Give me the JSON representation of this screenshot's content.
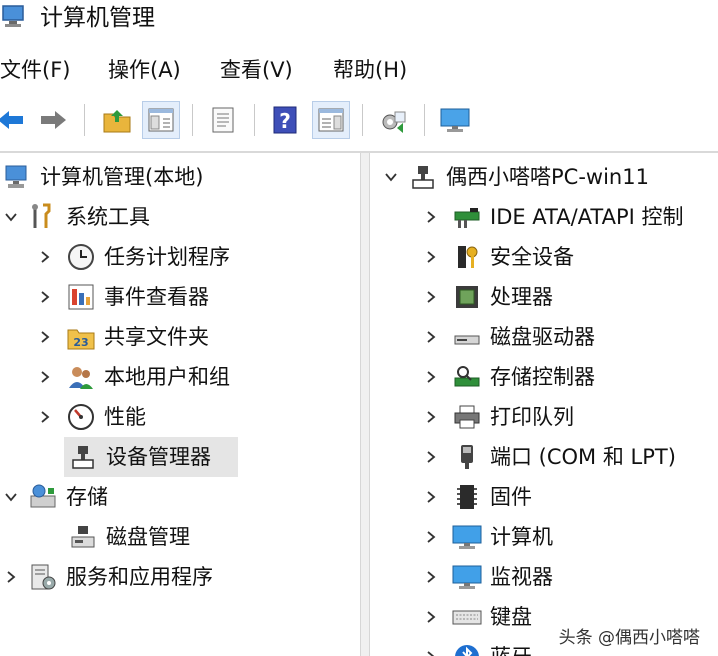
{
  "window": {
    "title": "计算机管理",
    "icon": "computer-management-icon"
  },
  "menu": [
    {
      "label": "文件(F)"
    },
    {
      "label": "操作(A)"
    },
    {
      "label": "查看(V)"
    },
    {
      "label": "帮助(H)"
    }
  ],
  "toolbar": {
    "buttons": [
      "back-arrow-icon",
      "forward-arrow-icon",
      "up-folder-icon",
      "show-hide-console-tree-icon",
      "properties-icon",
      "help-icon",
      "show-action-pane-icon",
      "export-list-icon",
      "monitor-icon"
    ],
    "pressed": [
      "show-hide-console-tree-icon",
      "show-action-pane-icon"
    ]
  },
  "left_tree": [
    {
      "label": "计算机管理(本地)",
      "icon": "computer-management-icon"
    },
    {
      "label": "系统工具",
      "icon": "tools-icon",
      "expanded": true
    },
    {
      "label": "任务计划程序",
      "icon": "clock-icon"
    },
    {
      "label": "事件查看器",
      "icon": "event-viewer-icon"
    },
    {
      "label": "共享文件夹",
      "icon": "shared-folder-icon"
    },
    {
      "label": "本地用户和组",
      "icon": "users-icon"
    },
    {
      "label": "性能",
      "icon": "performance-icon"
    },
    {
      "label": "设备管理器",
      "icon": "device-manager-icon",
      "selected": true
    },
    {
      "label": "存储",
      "icon": "storage-icon",
      "expanded": true
    },
    {
      "label": "磁盘管理",
      "icon": "disk-management-icon"
    },
    {
      "label": "服务和应用程序",
      "icon": "services-icon"
    }
  ],
  "right_tree": [
    {
      "label": "偶西小嗒嗒PC-win11",
      "icon": "computer-root-icon",
      "expanded": true
    },
    {
      "label": "IDE ATA/ATAPI 控制",
      "icon": "ide-controller-icon"
    },
    {
      "label": "安全设备",
      "icon": "security-device-icon"
    },
    {
      "label": "处理器",
      "icon": "processor-icon"
    },
    {
      "label": "磁盘驱动器",
      "icon": "disk-drive-icon"
    },
    {
      "label": "存储控制器",
      "icon": "storage-controller-icon"
    },
    {
      "label": "打印队列",
      "icon": "printer-icon"
    },
    {
      "label": "端口 (COM 和 LPT)",
      "icon": "port-icon"
    },
    {
      "label": "固件",
      "icon": "firmware-icon"
    },
    {
      "label": "计算机",
      "icon": "computer-icon"
    },
    {
      "label": "监视器",
      "icon": "monitor-icon"
    },
    {
      "label": "键盘",
      "icon": "keyboard-icon"
    },
    {
      "label": "蓝牙",
      "icon": "bluetooth-icon"
    }
  ],
  "watermark": "头条 @偶西小嗒嗒",
  "colors": {
    "selection": "#e5e5e5",
    "accent": "#1e78d7"
  }
}
